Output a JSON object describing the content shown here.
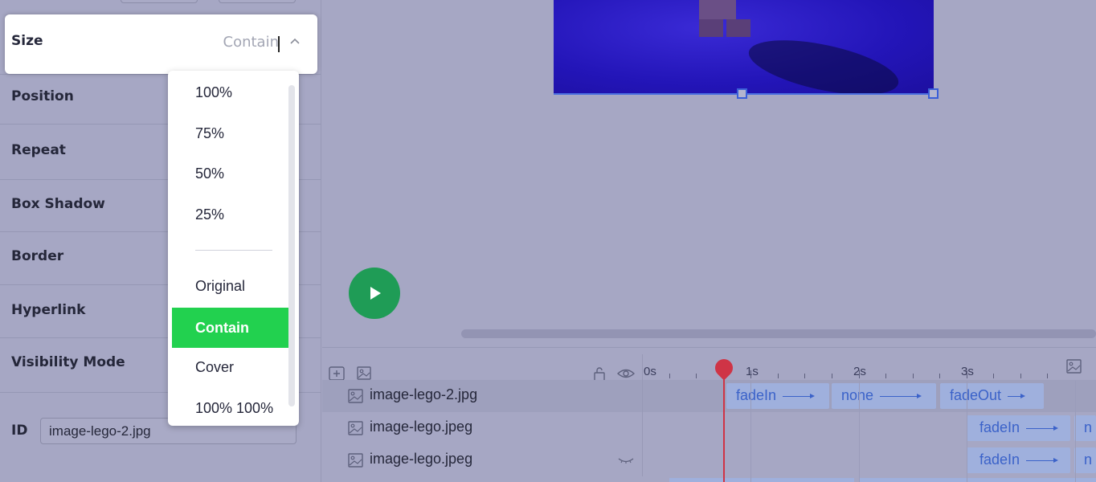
{
  "properties": {
    "size_label": "Size",
    "size_value": "Contain",
    "position": "Position",
    "repeat": "Repeat",
    "box_shadow": "Box Shadow",
    "border": "Border",
    "hyperlink": "Hyperlink",
    "visibility_mode": "Visibility Mode",
    "id_label": "ID",
    "id_value": "image-lego-2.jpg"
  },
  "size_menu": {
    "options": [
      "100%",
      "75%",
      "50%",
      "25%",
      "Original",
      "Contain",
      "Cover",
      "100% 100%"
    ],
    "selected": "Contain"
  },
  "timeline": {
    "ticks": [
      "0s",
      "1s",
      "2s",
      "3s"
    ],
    "layers": [
      {
        "name": "image-lego-2.jpg",
        "animations": [
          "fadeIn",
          "none",
          "fadeOut"
        ]
      },
      {
        "name": "image-lego.jpeg",
        "animations": [
          "fadeIn",
          "n"
        ]
      },
      {
        "name": "image-lego.jpeg",
        "animations": [
          "fadeIn",
          "n"
        ]
      }
    ]
  },
  "colors": {
    "accent_selected": "#22d14f",
    "play_button": "#1f9c56",
    "playhead": "#cf3446",
    "animation_text": "#3b62c9"
  },
  "icons": {
    "add_layer": "add-layer-icon",
    "add_image": "add-image-icon",
    "lock": "lock-icon",
    "visibility": "eye-icon",
    "image_layer": "image-icon",
    "hidden": "eye-closed-icon",
    "play": "play-icon",
    "chevron": "chevron-up-icon"
  }
}
